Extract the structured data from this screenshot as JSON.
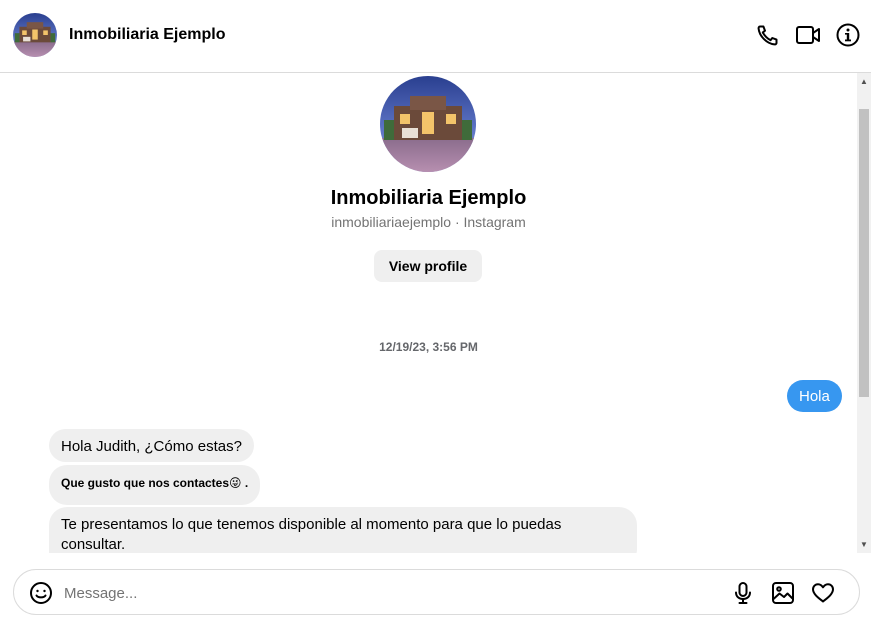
{
  "header": {
    "contact_name": "Inmobiliaria Ejemplo",
    "icons": [
      "phone-icon",
      "video-camera-icon",
      "info-icon"
    ]
  },
  "profile": {
    "name": "Inmobiliaria Ejemplo",
    "subtitle": "inmobiliariaejemplo · Instagram",
    "view_profile_label": "View profile"
  },
  "thread": {
    "timestamp": "12/19/23, 3:56 PM",
    "messages": [
      {
        "direction": "outgoing",
        "text": "Hola"
      },
      {
        "direction": "incoming",
        "text": "Hola  Judith, ¿Cómo estas?"
      },
      {
        "direction": "incoming",
        "text": "Que gusto que nos contactes",
        "emoji": "😜",
        "suffix": " ."
      },
      {
        "direction": "incoming",
        "text": "Te presentamos lo que tenemos disponible al momento para que lo puedas consultar."
      }
    ]
  },
  "composer": {
    "placeholder": "Message...",
    "value": "",
    "icons": [
      "emoji-icon",
      "microphone-icon",
      "image-icon",
      "heart-icon"
    ]
  },
  "colors": {
    "outgoing_bubble": "#3797f0",
    "incoming_bubble": "#efefef",
    "divider": "#dbdbdb"
  }
}
